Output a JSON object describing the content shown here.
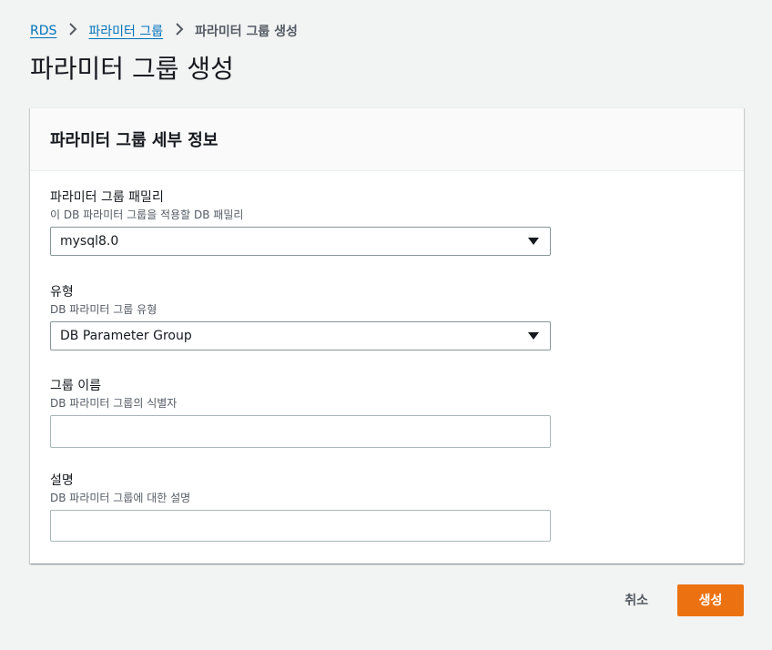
{
  "breadcrumb": {
    "items": [
      {
        "label": "RDS"
      },
      {
        "label": "파라미터 그룹"
      },
      {
        "label": "파라미터 그룹 생성"
      }
    ]
  },
  "page": {
    "title": "파라미터 그룹 생성"
  },
  "panel": {
    "title": "파라미터 그룹 세부 정보",
    "fields": {
      "family": {
        "label": "파라미터 그룹 패밀리",
        "description": "이 DB 파라미터 그룹을 적용할 DB 패밀리",
        "value": "mysql8.0"
      },
      "type": {
        "label": "유형",
        "description": "DB 파라미터 그룹 유형",
        "value": "DB Parameter Group"
      },
      "name": {
        "label": "그룹 이름",
        "description": "DB 파라미터 그룹의 식별자",
        "value": ""
      },
      "description": {
        "label": "설명",
        "description": "DB 파라미터 그룹에 대한 설명",
        "value": ""
      }
    }
  },
  "actions": {
    "cancel_label": "취소",
    "create_label": "생성"
  },
  "colors": {
    "primary_button": "#ec7211",
    "link": "#0073bb",
    "background": "#f2f3f3"
  }
}
